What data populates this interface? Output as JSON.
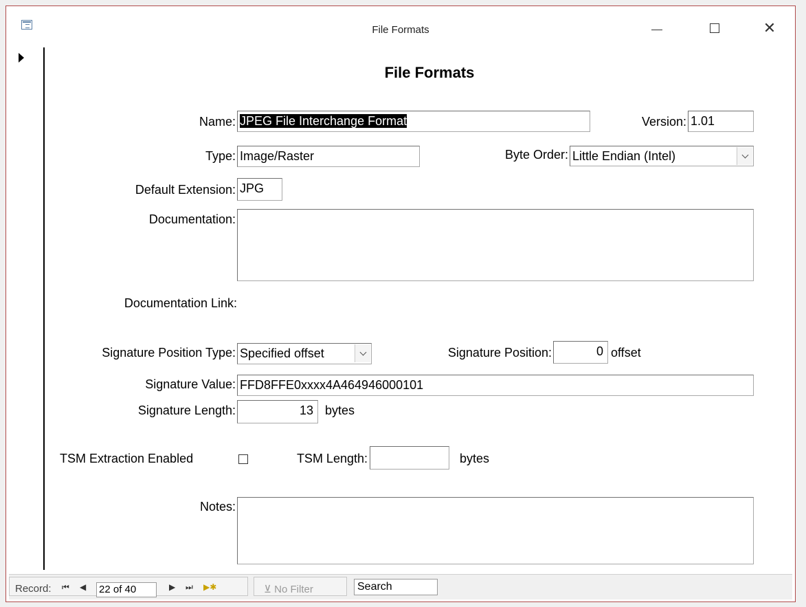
{
  "window": {
    "title": "File Formats"
  },
  "form": {
    "heading": "File Formats",
    "name_label": "Name:",
    "name_value": "JPEG File Interchange Format",
    "version_label": "Version:",
    "version_value": "1.01",
    "type_label": "Type:",
    "type_value": "Image/Raster",
    "byte_order_label": "Byte Order:",
    "byte_order_value": "Little Endian (Intel)",
    "default_ext_label": "Default Extension:",
    "default_ext_value": "JPG",
    "documentation_label": "Documentation:",
    "documentation_value": "",
    "documentation_link_label": "Documentation Link:",
    "sig_pos_type_label": "Signature Position Type:",
    "sig_pos_type_value": "Specified offset",
    "sig_position_label": "Signature Position:",
    "sig_position_value": "0",
    "sig_position_unit": "offset",
    "sig_value_label": "Signature Value:",
    "sig_value_value": "FFD8FFE0xxxx4A464946000101",
    "sig_length_label": "Signature Length:",
    "sig_length_value": "13",
    "sig_length_unit": "bytes",
    "tsm_enabled_label": "TSM Extraction Enabled",
    "tsm_enabled_checked": false,
    "tsm_length_label": "TSM Length:",
    "tsm_length_value": "",
    "tsm_length_unit": "bytes",
    "notes_label": "Notes:",
    "notes_value": ""
  },
  "navigation": {
    "record_label": "Record:",
    "first_icon": "first-record-icon",
    "prev_icon": "previous-record-icon",
    "current": "22 of 40",
    "next_icon": "next-record-icon",
    "last_icon": "last-record-icon",
    "new_icon": "new-record-icon",
    "filter_label": "No Filter",
    "search_label": "Search"
  }
}
